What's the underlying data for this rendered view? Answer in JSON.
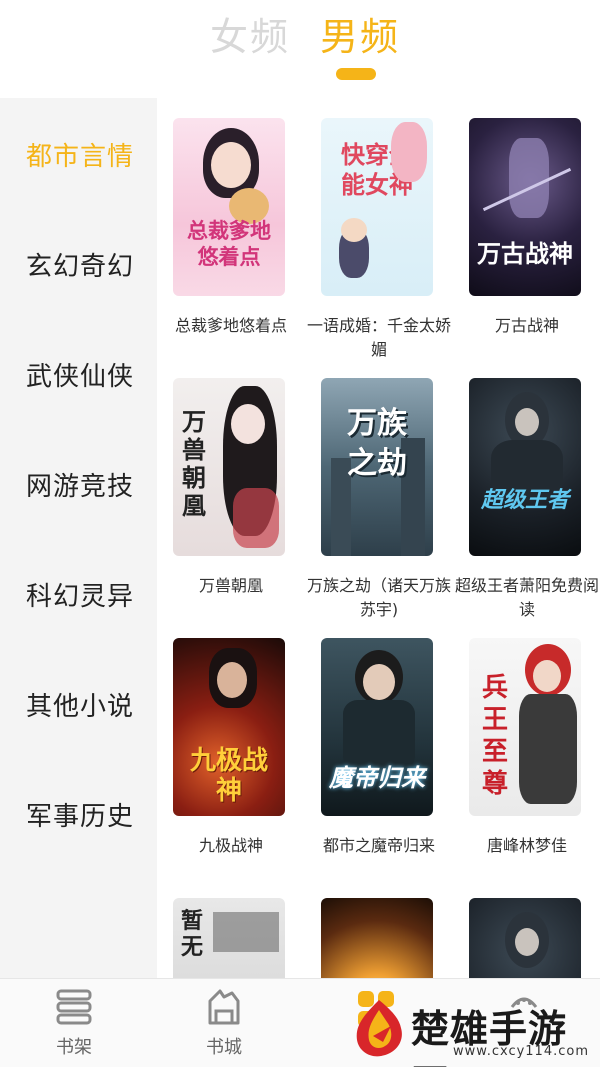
{
  "header": {
    "tabs": [
      {
        "label": "女频",
        "active": false
      },
      {
        "label": "男频",
        "active": true
      }
    ]
  },
  "colors": {
    "accent": "#f5b418",
    "inactive_tab": "#d8d8d8",
    "sidebar_bg": "#f4f4f4"
  },
  "sidebar": {
    "items": [
      {
        "label": "都市言情",
        "active": true
      },
      {
        "label": "玄幻奇幻",
        "active": false
      },
      {
        "label": "武侠仙侠",
        "active": false
      },
      {
        "label": "网游竞技",
        "active": false
      },
      {
        "label": "科幻灵异",
        "active": false
      },
      {
        "label": "其他小说",
        "active": false
      },
      {
        "label": "军事历史",
        "active": false
      }
    ]
  },
  "books": [
    {
      "title": "总裁爹地悠着点",
      "cover_text": "总裁爹地悠着点"
    },
    {
      "title": "一语成婚：千金太娇媚",
      "cover_text": "快穿全能女神"
    },
    {
      "title": "万古战神",
      "cover_text": "万古战神"
    },
    {
      "title": "万兽朝凰",
      "cover_text": "万兽朝凰"
    },
    {
      "title": "万族之劫（诸天万族苏宇)",
      "cover_text": "万族之劫"
    },
    {
      "title": "超级王者萧阳免费阅读",
      "cover_text": "超级王者"
    },
    {
      "title": "九极战神",
      "cover_text": "九极战神"
    },
    {
      "title": "都市之魔帝归来",
      "cover_text": "魔帝归来"
    },
    {
      "title": "唐峰林梦佳",
      "cover_text": "兵王至尊"
    },
    {
      "title": "",
      "cover_text": "暂无"
    },
    {
      "title": "",
      "cover_text": ""
    },
    {
      "title": "",
      "cover_text": ""
    }
  ],
  "bottom_nav": {
    "items": [
      {
        "label": "书架",
        "icon": "bookshelf-icon"
      },
      {
        "label": "书城",
        "icon": "bookstore-icon"
      },
      {
        "label": "",
        "icon": "category-icon"
      },
      {
        "label": "",
        "icon": "profile-icon"
      }
    ]
  },
  "watermark": {
    "text": "楚雄手游网",
    "url": "www.cxcy114.com"
  }
}
